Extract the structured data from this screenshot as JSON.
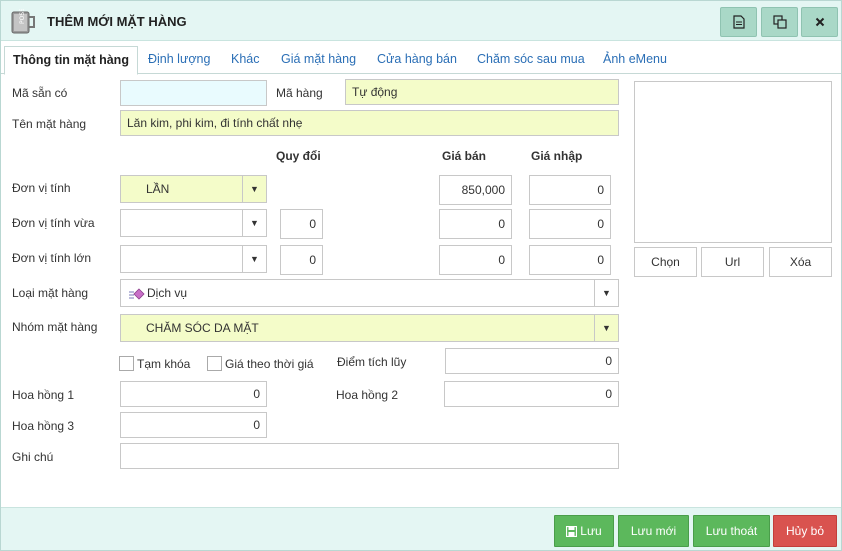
{
  "window": {
    "title": "THÊM MỚI MẶT HÀNG"
  },
  "tabs": [
    {
      "label": "Thông tin mặt hàng"
    },
    {
      "label": "Định lượng"
    },
    {
      "label": "Khác"
    },
    {
      "label": "Giá mặt hàng"
    },
    {
      "label": "Cửa hàng bán"
    },
    {
      "label": "Chăm sóc sau mua"
    },
    {
      "label": "Ảnh eMenu"
    }
  ],
  "form": {
    "ma_san_co": {
      "label": "Mã sẵn có",
      "value": ""
    },
    "ma_hang": {
      "label": "Mã hàng",
      "value": "Tự động"
    },
    "ten_mat_hang": {
      "label": "Tên mặt hàng",
      "value": "Lăn kim, phi kim, đi tính chất nhẹ"
    },
    "headers": {
      "quy_doi": "Quy đổi",
      "gia_ban": "Giá bán",
      "gia_nhap": "Giá nhập"
    },
    "don_vi_tinh": {
      "label": "Đơn vị tính",
      "value": "LẦN",
      "gia_ban": "850,000",
      "gia_nhap": "0"
    },
    "don_vi_tinh_vua": {
      "label": "Đơn vị tính vừa",
      "value": "",
      "quy_doi": "0",
      "gia_ban": "0",
      "gia_nhap": "0"
    },
    "don_vi_tinh_lon": {
      "label": "Đơn vị tính lớn",
      "value": "",
      "quy_doi": "0",
      "gia_ban": "0",
      "gia_nhap": "0"
    },
    "loai_mat_hang": {
      "label": "Loại mặt hàng",
      "value": "Dịch vụ"
    },
    "nhom_mat_hang": {
      "label": "Nhóm mặt hàng",
      "value": "CHĂM SÓC DA MẶT"
    },
    "tam_khoa": {
      "label": "Tạm khóa",
      "checked": false
    },
    "gia_theo_thoi_gia": {
      "label": "Giá theo thời giá",
      "checked": false
    },
    "diem_tich_luy": {
      "label": "Điểm tích lũy",
      "value": "0"
    },
    "hoa_hong_1": {
      "label": "Hoa hồng 1",
      "value": "0"
    },
    "hoa_hong_2": {
      "label": "Hoa hồng 2",
      "value": "0"
    },
    "hoa_hong_3": {
      "label": "Hoa hồng 3",
      "value": "0"
    },
    "ghi_chu": {
      "label": "Ghi chú",
      "value": ""
    }
  },
  "image": {
    "chon": "Chọn",
    "url": "Url",
    "xoa": "Xóa"
  },
  "footer": {
    "luu": "Lưu",
    "luu_moi": "Lưu mới",
    "luu_thoat": "Lưu thoát",
    "huy_bo": "Hủy bỏ"
  },
  "colors": {
    "accent_green": "#5cb85c",
    "danger_red": "#d9534f",
    "tab_link": "#2b6fb6",
    "yellow_field": "#f4fcc9",
    "header_bg": "#e4f6f3"
  }
}
